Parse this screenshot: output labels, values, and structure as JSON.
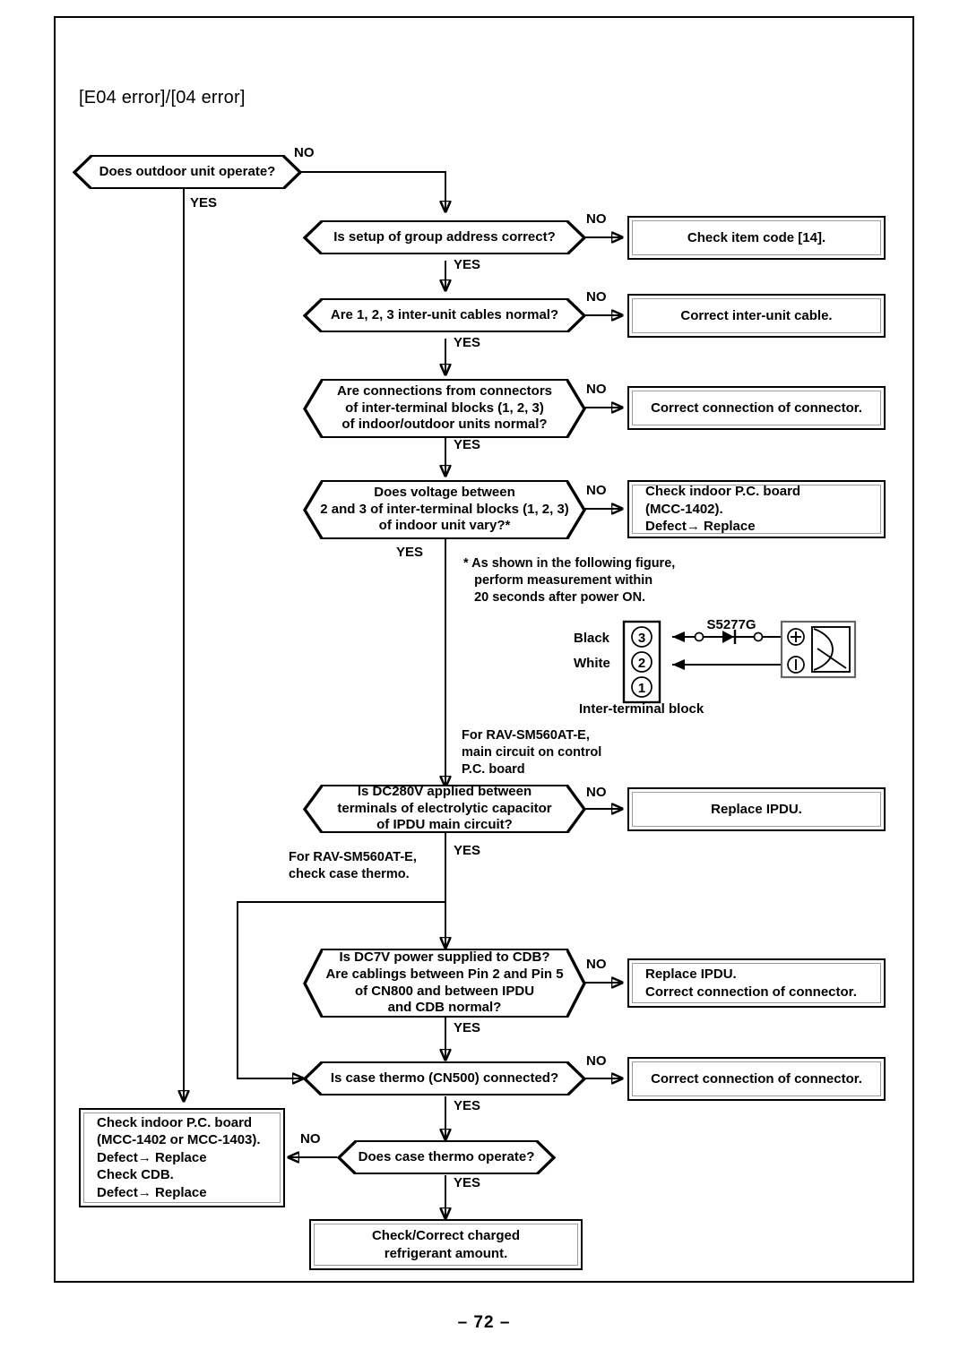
{
  "page": {
    "title": "[E04 error]/[04 error]",
    "page_number": "– 72 –"
  },
  "flow": {
    "decisions": [
      {
        "id": "d1",
        "text": "Does outdoor unit operate?"
      },
      {
        "id": "d2",
        "text": "Is setup of group address correct?"
      },
      {
        "id": "d3",
        "text": "Are 1, 2, 3 inter-unit cables normal?"
      },
      {
        "id": "d4",
        "line1": "Are connections from connectors",
        "line2": "of inter-terminal blocks (1, 2, 3)",
        "line3": "of indoor/outdoor units normal?"
      },
      {
        "id": "d5",
        "line1": "Does voltage between",
        "line2": "2 and 3 of inter-terminal blocks (1, 2, 3)",
        "line3": "of indoor unit vary?*"
      },
      {
        "id": "d6",
        "line1": "Is DC280V applied between",
        "line2": "terminals of electrolytic capacitor",
        "line3": "of IPDU main circuit?"
      },
      {
        "id": "d7",
        "line1": "Is DC7V power supplied to CDB?",
        "line2": "Are cablings between Pin 2 and Pin 5",
        "line3": "of CN800 and between IPDU",
        "line4": "and CDB normal?"
      },
      {
        "id": "d8",
        "text": "Is case thermo (CN500) connected?"
      },
      {
        "id": "d9",
        "text": "Does case thermo operate?"
      }
    ],
    "results": [
      {
        "id": "r1",
        "text": "Check item code [14]."
      },
      {
        "id": "r2",
        "text": "Correct inter-unit cable."
      },
      {
        "id": "r3",
        "text": "Correct connection of connector."
      },
      {
        "id": "r4",
        "line1": "Check indoor P.C. board",
        "line2": "(MCC-1402).",
        "line3": "Defect→ Replace"
      },
      {
        "id": "r5",
        "text": "Replace IPDU."
      },
      {
        "id": "r6",
        "line1": "Replace IPDU.",
        "line2": "Correct connection of connector."
      },
      {
        "id": "r7",
        "text": "Correct connection of connector."
      },
      {
        "id": "r8",
        "line1": "Check indoor P.C. board",
        "line2": "(MCC-1402 or MCC-1403).",
        "line3": "Defect→ Replace",
        "line4": "Check CDB.",
        "line5": "Defect→ Replace"
      },
      {
        "id": "r9",
        "line1": "Check/Correct charged",
        "line2": "refrigerant amount."
      }
    ],
    "branch_labels": {
      "no": "NO",
      "yes": "YES"
    }
  },
  "notes": {
    "asterisk": "* As shown in the following figure,\n   perform measurement within\n   20 seconds after power ON.",
    "control_board": "For RAV-SM560AT-E,\nmain circuit on control\nP.C. board",
    "case_thermo": "For RAV-SM560AT-E,\ncheck case thermo."
  },
  "figure": {
    "name": "inter-terminal-block-measurement",
    "device_label": "S5277G",
    "caption": "Inter-terminal block",
    "wire_black": "Black",
    "wire_white": "White",
    "terminals": [
      "3",
      "2",
      "1"
    ],
    "meter_plus": "⊕",
    "meter_minus": "⊖"
  }
}
